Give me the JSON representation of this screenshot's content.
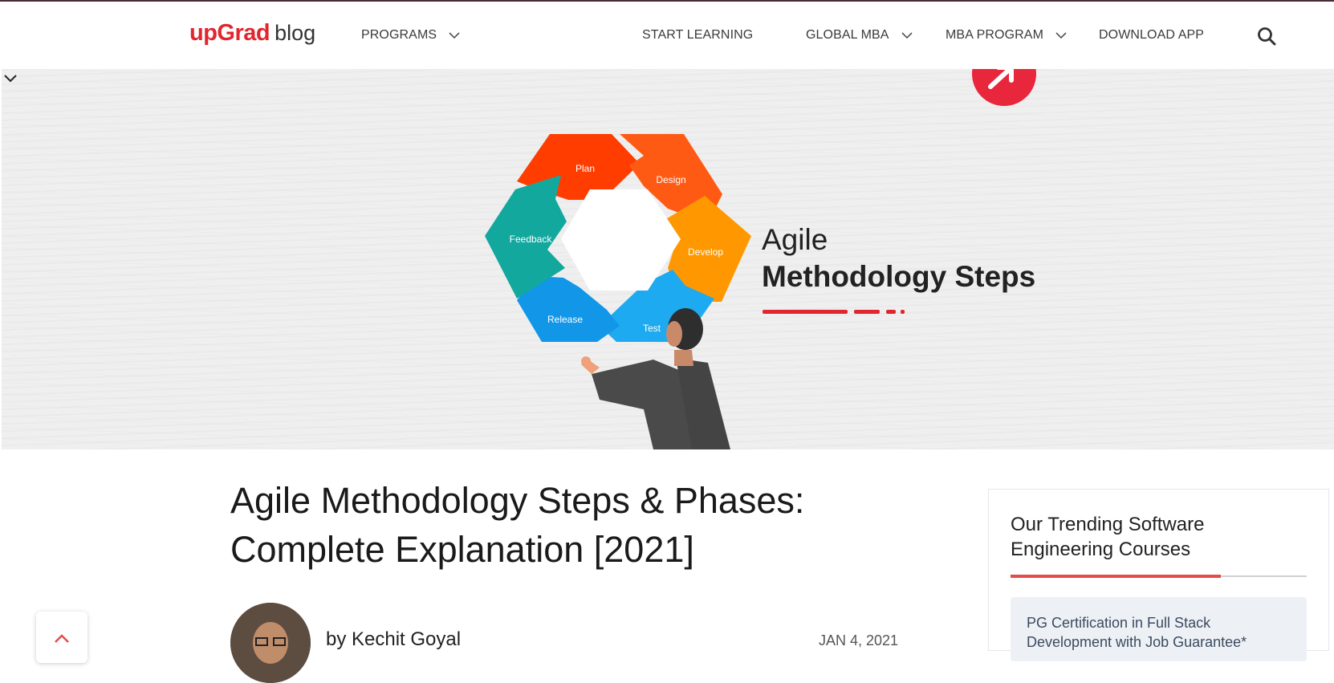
{
  "nav": {
    "logo_brand": "upGrad",
    "logo_sub": "blog",
    "items": [
      {
        "label": "PROGRAMS"
      },
      {
        "label": "START LEARNING"
      },
      {
        "label": "GLOBAL MBA"
      },
      {
        "label": "MBA PROGRAM"
      },
      {
        "label": "DOWNLOAD APP"
      }
    ],
    "search_icon": "search-icon"
  },
  "hero": {
    "title_line1": "Agile",
    "title_line2": "Methodology Steps",
    "cycle_labels": [
      "Plan",
      "Design",
      "Develop",
      "Test",
      "Release",
      "Feedback"
    ],
    "colors": {
      "plan": "#ff3d00",
      "design": "#ff5a14",
      "develop": "#ff9800",
      "test": "#1eaaf0",
      "release": "#1296e8",
      "feedback": "#13a89e",
      "accent": "#e0262e"
    }
  },
  "article": {
    "title": "Agile Methodology Steps & Phases: Complete Explanation [2021]",
    "author": "by Kechit Goyal",
    "date": "JAN 4, 2021"
  },
  "sidebar": {
    "title": "Our Trending Software Engineering Courses",
    "course_1": "PG Certification in Full Stack Development with Job Guarantee*"
  }
}
